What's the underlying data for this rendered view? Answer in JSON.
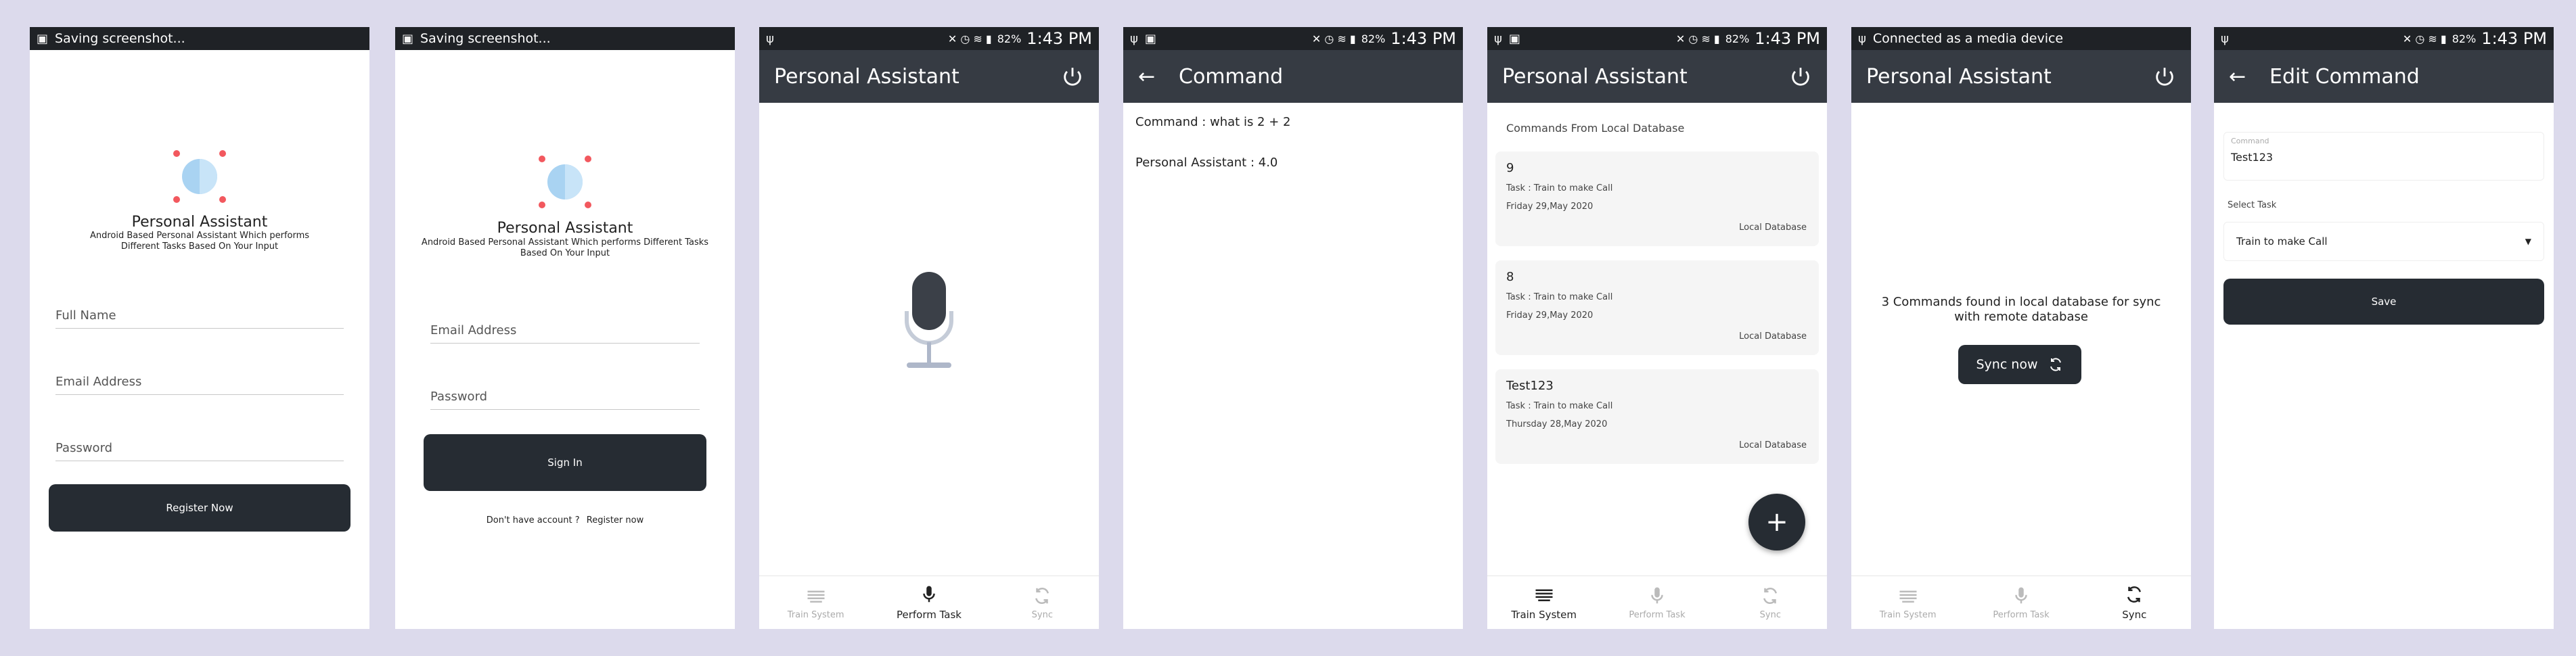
{
  "screens": {
    "register": {
      "status_text": "Saving screenshot...",
      "app_name": "Personal Assistant",
      "subtitle": "Android Based Personal Assistant Which performs Different Tasks Based On Your Input",
      "full_name_placeholder": "Full Name",
      "email_placeholder": "Email Address",
      "password_placeholder": "Password",
      "register_button": "Register Now"
    },
    "signin": {
      "status_text": "Saving screenshot...",
      "app_name": "Personal Assistant",
      "subtitle": "Android Based Personal Assistant Which performs Different Tasks Based On Your Input",
      "email_placeholder": "Email Address",
      "password_placeholder": "Password",
      "signin_button": "Sign In",
      "no_account_text": "Don't have account ?",
      "register_link": "Register now"
    },
    "perform": {
      "battery": "82%",
      "time": "1:43 PM",
      "title": "Personal Assistant"
    },
    "command": {
      "battery": "82%",
      "time": "1:43 PM",
      "title": "Command",
      "command_line": "Command : what is 2 + 2",
      "response_line": "Personal Assistant : 4.0"
    },
    "train": {
      "battery": "82%",
      "time": "1:43 PM",
      "title": "Personal Assistant",
      "section_header": "Commands From Local Database",
      "cards": [
        {
          "title": "9",
          "task": "Task : Train to make Call",
          "date": "Friday 29,May 2020",
          "badge": "Local Database"
        },
        {
          "title": "8",
          "task": "Task : Train to make Call",
          "date": "Friday 29,May 2020",
          "badge": "Local Database"
        },
        {
          "title": "Test123",
          "task": "Task : Train to make Call",
          "date": "Thursday 28,May 2020",
          "badge": "Local Database"
        }
      ],
      "fab_label": "+"
    },
    "sync": {
      "status_text": "Connected as a media device",
      "title": "Personal Assistant",
      "message": "3 Commands found in local database for sync with remote database",
      "sync_button": "Sync now"
    },
    "edit": {
      "battery": "82%",
      "time": "1:43 PM",
      "title": "Edit Command",
      "command_label": "Command",
      "command_value": "Test123",
      "select_label": "Select Task",
      "select_value": "Train to make Call",
      "save_button": "Save"
    }
  },
  "nav": {
    "train": "Train System",
    "perform": "Perform Task",
    "sync": "Sync"
  },
  "colors": {
    "appbar": "#363b43",
    "statusbar": "#1f2226",
    "button": "#262c33",
    "background": "#dcdaec"
  }
}
